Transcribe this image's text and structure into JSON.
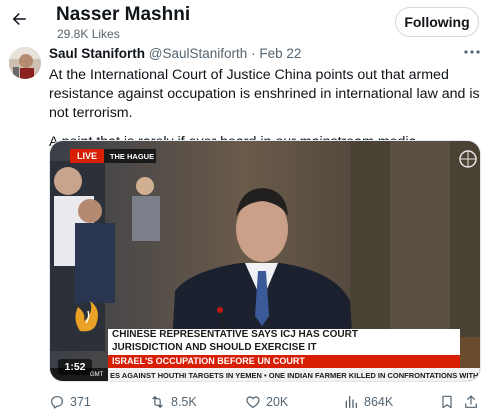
{
  "header": {
    "title": "Nasser Mashni",
    "likes": "29.8K Likes",
    "follow_label": "Following"
  },
  "tweet": {
    "author_name": "Saul Staniforth",
    "author_handle": "@SaulStaniforth",
    "separator": "·",
    "date": "Feb 22",
    "text_lines": [
      "At the International Court of Justice China points out that armed resistance against occupation is enshrined in international law and is not terrorism.",
      "A point that is rarely if ever heard in our mainstream media."
    ]
  },
  "video": {
    "live_label": "LIVE",
    "location": "THE HAGUE",
    "headline_1": "CHINESE REPRESENTATIVE SAYS ICJ HAS COURT",
    "headline_2": "JURISDICTION AND SHOULD EXERCISE IT",
    "headline_3": "ISRAEL'S OCCUPATION BEFORE UN COURT",
    "ticker": "ES AGAINST HOUTHI TARGETS IN YEMEN  •  ONE INDIAN FARMER KILLED IN CONFRONTATIONS WITH",
    "duration": "1:52",
    "time_label": "GMT",
    "un_emblem": "UN"
  },
  "actions": {
    "replies": "371",
    "reposts": "8.5K",
    "likes": "20K",
    "views": "864K"
  },
  "colors": {
    "text": "#0f1419",
    "muted": "#536471",
    "border": "#cfd9de",
    "live_red": "#d81e05"
  }
}
